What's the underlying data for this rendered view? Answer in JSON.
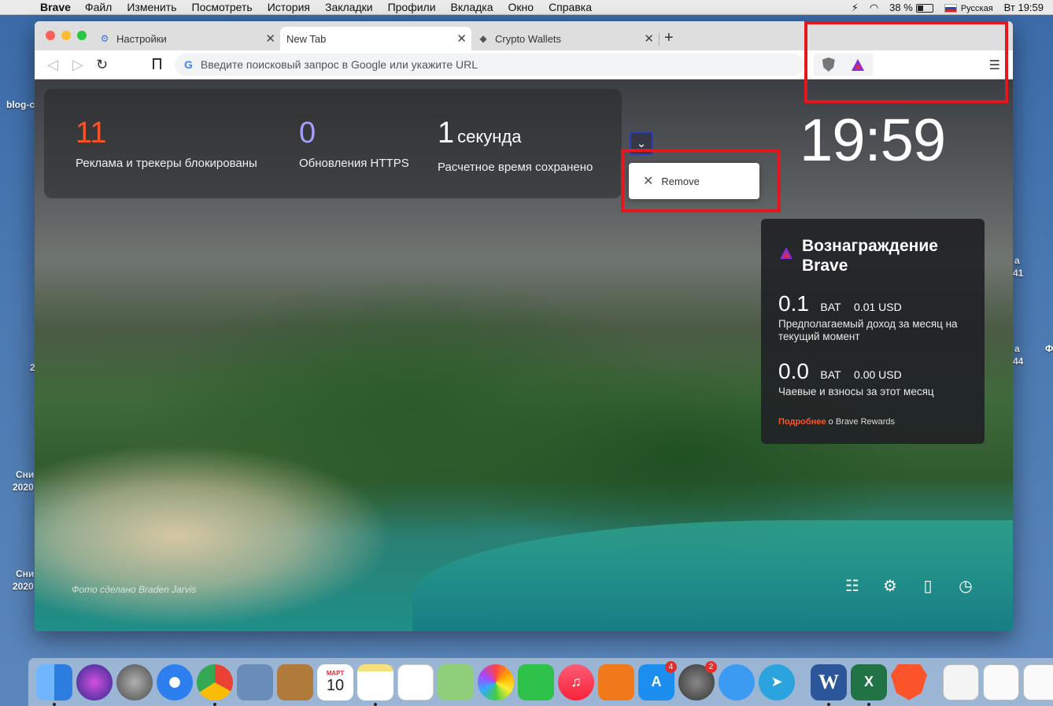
{
  "menubar": {
    "app_name": "Brave",
    "items": [
      "Файл",
      "Изменить",
      "Посмотреть",
      "История",
      "Закладки",
      "Профили",
      "Вкладка",
      "Окно",
      "Справка"
    ],
    "battery": "38 %",
    "input_source": "Русская",
    "clock": "Вт 19:59"
  },
  "desktop": {
    "labels": [
      "blog-c",
      "2",
      "Сни",
      "2020",
      "Сни",
      "2020",
      "а",
      "41",
      "а",
      "44",
      "Ф"
    ]
  },
  "tabs": [
    {
      "label": "Настройки",
      "icon": "gear-icon"
    },
    {
      "label": "New Tab",
      "icon": "none"
    },
    {
      "label": "Crypto Wallets",
      "icon": "ethereum-icon"
    }
  ],
  "toolbar": {
    "url_placeholder": "Введите поисковый запрос в Google или укажите URL"
  },
  "stats": {
    "ads_count": "11",
    "ads_label": "Реклама и трекеры блокированы",
    "https_count": "0",
    "https_label": "Обновления HTTPS",
    "time_value": "1",
    "time_unit": "секунда",
    "time_label": "Расчетное время сохранено"
  },
  "context_menu": {
    "remove_label": "Remove"
  },
  "clock": "19:59",
  "rewards": {
    "title_line1": "Вознаграждение",
    "title_line2": "Brave",
    "estimate_value": "0.1",
    "estimate_unit": "BAT",
    "estimate_usd": "0.01 USD",
    "estimate_desc": "Предполагаемый доход за месяц на текущий момент",
    "tips_value": "0.0",
    "tips_unit": "BAT",
    "tips_usd": "0.00 USD",
    "tips_desc": "Чаевые и взносы за этот месяц",
    "more_link": "Подробнее",
    "more_text": "о Brave Rewards"
  },
  "photo_credit": "Фото сделано Braden Jarvis",
  "dock": {
    "calendar_month": "МАРТ",
    "calendar_day": "10",
    "appstore_badge": "4",
    "prefs_badge": "2"
  },
  "colors": {
    "ads_count": "#fb542b",
    "https_count": "#a49ffc",
    "highlight": "#e4171f",
    "link": "#fb542b"
  }
}
